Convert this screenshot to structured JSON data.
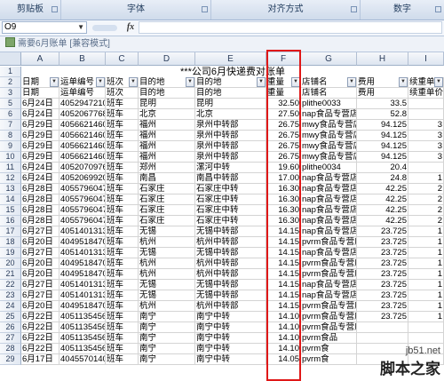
{
  "ribbon": {
    "groups": [
      "剪贴板",
      "字体",
      "对齐方式",
      "数字"
    ]
  },
  "formula_bar": {
    "name_box": "O9",
    "fx_label": "fx",
    "content": ""
  },
  "document": {
    "title": "需要6月账单 [兼容模式]"
  },
  "columns": [
    "A",
    "B",
    "C",
    "D",
    "E",
    "F",
    "G",
    "H",
    "I"
  ],
  "sheet": {
    "title": "***公司6月快递费对账单",
    "filter_headers": [
      "日期",
      "运单编号",
      "班次",
      "目的地",
      "目的地",
      "重量",
      "店铺名",
      "费用",
      "续重单价"
    ],
    "headers": [
      "日期",
      "运单编号",
      "班次",
      "目的地",
      "目的地",
      "重量",
      "店铺名",
      "费用",
      "续重单价"
    ],
    "rows": [
      {
        "n": "5",
        "date": "6月24日",
        "no": "4052947210",
        "cls": "班车",
        "d1": "昆明",
        "d2": "昆明",
        "w": "32.50",
        "shop": "plithe0033",
        "fee": "33.5",
        "u": ""
      },
      {
        "n": "6",
        "date": "6月24日",
        "no": "4052067768",
        "cls": "班车",
        "d1": "北京",
        "d2": "北京",
        "w": "27.50",
        "shop": "nap食品专营店",
        "fee": "52.8",
        "u": ""
      },
      {
        "n": "7",
        "date": "6月29日",
        "no": "4056621460",
        "cls": "班车",
        "d1": "福州",
        "d2": "泉州中转部",
        "w": "26.75",
        "shop": "mwy食品专营店",
        "fee": "94.125",
        "u": "3"
      },
      {
        "n": "8",
        "date": "6月29日",
        "no": "4056621460",
        "cls": "班车",
        "d1": "福州",
        "d2": "泉州中转部",
        "w": "26.75",
        "shop": "mwy食品专营店",
        "fee": "94.125",
        "u": "3"
      },
      {
        "n": "9",
        "date": "6月29日",
        "no": "4056621460",
        "cls": "班车",
        "d1": "福州",
        "d2": "泉州中转部",
        "w": "26.75",
        "shop": "mwy食品专营店",
        "fee": "94.125",
        "u": "3"
      },
      {
        "n": "10",
        "date": "6月29日",
        "no": "4056621460",
        "cls": "班车",
        "d1": "福州",
        "d2": "泉州中转部",
        "w": "26.75",
        "shop": "mwy食品专营店",
        "fee": "94.125",
        "u": "3"
      },
      {
        "n": "11",
        "date": "6月24日",
        "no": "4052070976",
        "cls": "班车",
        "d1": "郑州",
        "d2": "漯河中转",
        "w": "19.60",
        "shop": "plithe0034",
        "fee": "20.4",
        "u": ""
      },
      {
        "n": "12",
        "date": "6月24日",
        "no": "4052069920",
        "cls": "班车",
        "d1": "南昌",
        "d2": "南昌中转部",
        "w": "17.00",
        "shop": "nap食品专营店",
        "fee": "24.8",
        "u": "1"
      },
      {
        "n": "13",
        "date": "6月28日",
        "no": "4055796047",
        "cls": "班车",
        "d1": "石家庄",
        "d2": "石家庄中转",
        "w": "16.30",
        "shop": "nap食品专营店",
        "fee": "42.25",
        "u": "2"
      },
      {
        "n": "14",
        "date": "6月28日",
        "no": "4055796047",
        "cls": "班车",
        "d1": "石家庄",
        "d2": "石家庄中转",
        "w": "16.30",
        "shop": "nap食品专营店",
        "fee": "42.25",
        "u": "2"
      },
      {
        "n": "15",
        "date": "6月28日",
        "no": "4055796047",
        "cls": "班车",
        "d1": "石家庄",
        "d2": "石家庄中转",
        "w": "16.30",
        "shop": "nap食品专营店",
        "fee": "42.25",
        "u": "2"
      },
      {
        "n": "16",
        "date": "6月28日",
        "no": "4055796047",
        "cls": "班车",
        "d1": "石家庄",
        "d2": "石家庄中转",
        "w": "16.30",
        "shop": "nap食品专营店",
        "fee": "42.25",
        "u": "2"
      },
      {
        "n": "17",
        "date": "6月27日",
        "no": "4051401313",
        "cls": "班车",
        "d1": "无锡",
        "d2": "无锡中转部",
        "w": "14.15",
        "shop": "nap食品专营店",
        "fee": "23.725",
        "u": "1"
      },
      {
        "n": "18",
        "date": "6月20日",
        "no": "4049518470",
        "cls": "班车",
        "d1": "杭州",
        "d2": "杭州中转部",
        "w": "14.15",
        "shop": "pvrm食品专营店",
        "fee": "23.725",
        "u": "1"
      },
      {
        "n": "19",
        "date": "6月27日",
        "no": "4051401313",
        "cls": "班车",
        "d1": "无锡",
        "d2": "无锡中转部",
        "w": "14.15",
        "shop": "nap食品专营店",
        "fee": "23.725",
        "u": "1"
      },
      {
        "n": "20",
        "date": "6月20日",
        "no": "4049518470",
        "cls": "班车",
        "d1": "杭州",
        "d2": "杭州中转部",
        "w": "14.15",
        "shop": "pvrm食品专营店",
        "fee": "23.725",
        "u": "1"
      },
      {
        "n": "21",
        "date": "6月20日",
        "no": "4049518470",
        "cls": "班车",
        "d1": "杭州",
        "d2": "杭州中转部",
        "w": "14.15",
        "shop": "pvrm食品专营店",
        "fee": "23.725",
        "u": "1"
      },
      {
        "n": "22",
        "date": "6月27日",
        "no": "4051401313",
        "cls": "班车",
        "d1": "无锡",
        "d2": "无锡中转部",
        "w": "14.15",
        "shop": "nap食品专营店",
        "fee": "23.725",
        "u": "1"
      },
      {
        "n": "23",
        "date": "6月27日",
        "no": "4051401313",
        "cls": "班车",
        "d1": "无锡",
        "d2": "无锡中转部",
        "w": "14.15",
        "shop": "nap食品专营店",
        "fee": "23.725",
        "u": "1"
      },
      {
        "n": "24",
        "date": "6月20日",
        "no": "4049518470",
        "cls": "班车",
        "d1": "杭州",
        "d2": "杭州中转部",
        "w": "14.15",
        "shop": "pvrm食品专营店",
        "fee": "23.725",
        "u": "1"
      },
      {
        "n": "25",
        "date": "6月22日",
        "no": "4051135456",
        "cls": "班车",
        "d1": "南宁",
        "d2": "南宁中转",
        "w": "14.10",
        "shop": "pvrm食品专营店",
        "fee": "23.725",
        "u": "1"
      },
      {
        "n": "26",
        "date": "6月22日",
        "no": "4051135456",
        "cls": "班车",
        "d1": "南宁",
        "d2": "南宁中转",
        "w": "14.10",
        "shop": "pvrm食品专营店",
        "fee": "",
        "u": ""
      },
      {
        "n": "27",
        "date": "6月22日",
        "no": "4051135456",
        "cls": "班车",
        "d1": "南宁",
        "d2": "南宁中转",
        "w": "14.10",
        "shop": "pvrm食品",
        "fee": "",
        "u": ""
      },
      {
        "n": "28",
        "date": "6月22日",
        "no": "4051135456",
        "cls": "班车",
        "d1": "南宁",
        "d2": "南宁中转",
        "w": "14.10",
        "shop": "pvrm食",
        "fee": "",
        "u": ""
      },
      {
        "n": "29",
        "date": "6月17日",
        "no": "4045570140",
        "cls": "班车",
        "d1": "南宁",
        "d2": "南宁中转",
        "w": "14.05",
        "shop": "pvrm食",
        "fee": "",
        "u": ""
      }
    ]
  },
  "watermark": {
    "site": "jb51.net",
    "name": "脚本之家"
  },
  "colors": {
    "highlight_border": "#e01818",
    "ribbon_text": "#1e395b",
    "header_bg": "#dde5f0"
  }
}
